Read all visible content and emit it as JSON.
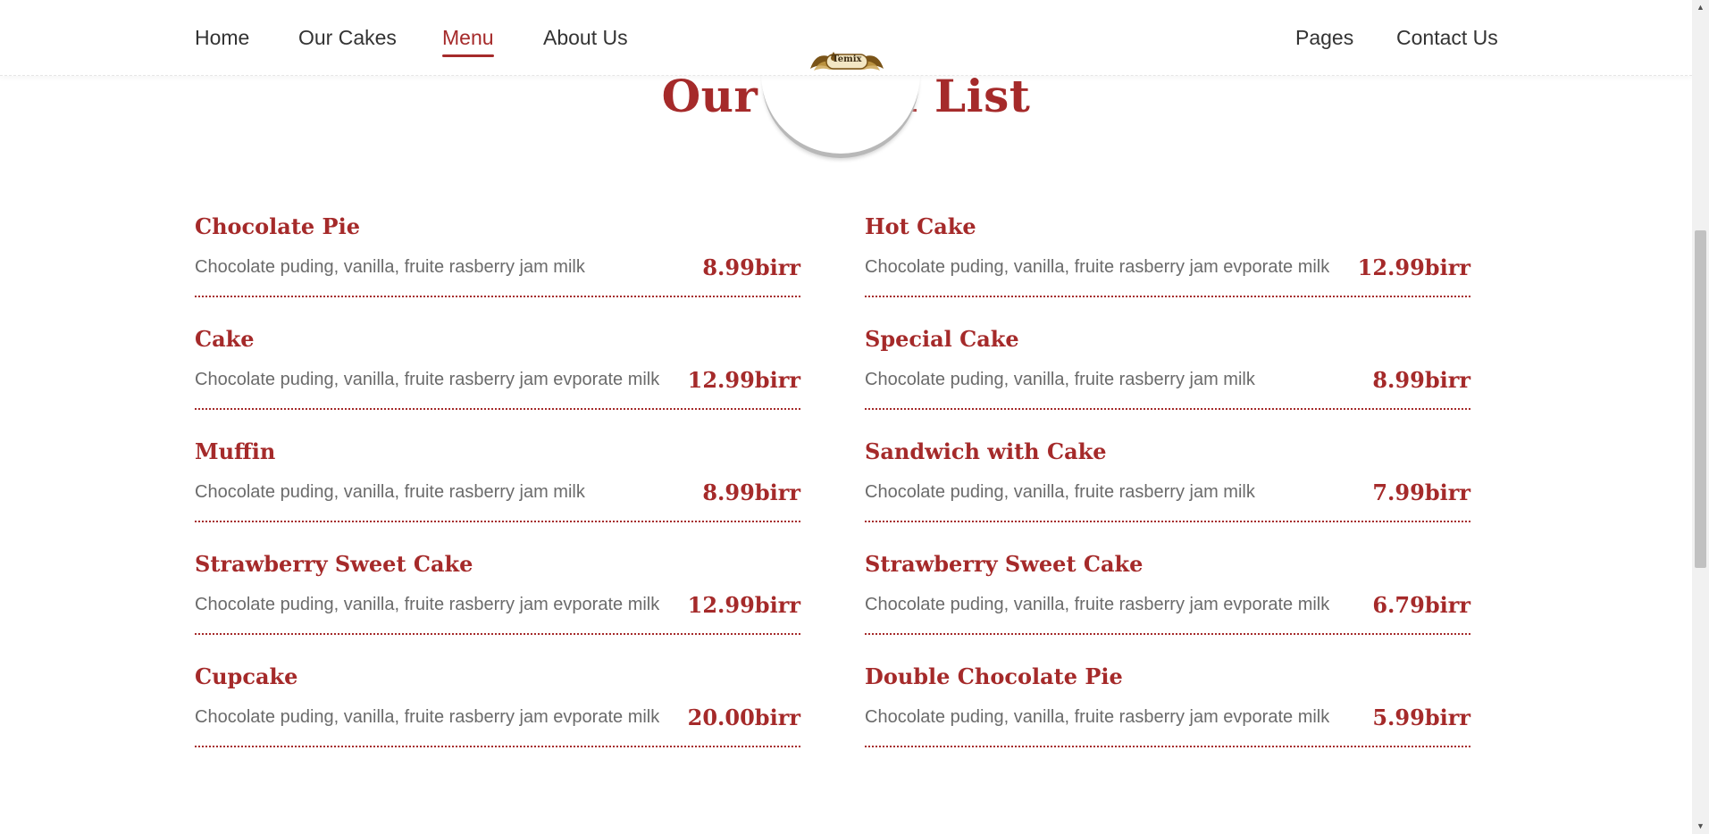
{
  "nav": {
    "left_links": [
      "Home",
      "Our Cakes",
      "Menu",
      "About Us"
    ],
    "right_links": [
      "Pages",
      "Contact Us"
    ],
    "active": "Menu"
  },
  "logo": {
    "text": "Temix",
    "icon": "cake-logo-icon"
  },
  "section": {
    "title": "Our Menu List"
  },
  "menu": {
    "left": [
      {
        "name": "Chocolate Pie",
        "description": "Chocolate puding, vanilla, fruite rasberry jam milk",
        "price": "8.99birr"
      },
      {
        "name": "Cake",
        "description": "Chocolate puding, vanilla, fruite rasberry jam evporate milk",
        "price": "12.99birr"
      },
      {
        "name": "Muffin",
        "description": "Chocolate puding, vanilla, fruite rasberry jam milk",
        "price": "8.99birr"
      },
      {
        "name": "Strawberry Sweet Cake",
        "description": "Chocolate puding, vanilla, fruite rasberry jam evporate milk",
        "price": "12.99birr"
      },
      {
        "name": "Cupcake",
        "description": "Chocolate puding, vanilla, fruite rasberry jam evporate milk",
        "price": "20.00birr"
      }
    ],
    "right": [
      {
        "name": "Hot Cake",
        "description": "Chocolate puding, vanilla, fruite rasberry jam evporate milk",
        "price": "12.99birr"
      },
      {
        "name": "Special Cake",
        "description": "Chocolate puding, vanilla, fruite rasberry jam milk",
        "price": "8.99birr"
      },
      {
        "name": "Sandwich with Cake",
        "description": "Chocolate puding, vanilla, fruite rasberry jam milk",
        "price": "7.99birr"
      },
      {
        "name": "Strawberry Sweet Cake",
        "description": "Chocolate puding, vanilla, fruite rasberry jam evporate milk",
        "price": "6.79birr"
      },
      {
        "name": "Double Chocolate Pie",
        "description": "Chocolate puding, vanilla, fruite rasberry jam evporate milk",
        "price": "5.99birr"
      }
    ]
  },
  "colors": {
    "accent": "#a52a2a",
    "nav_text": "#333333",
    "description_text": "#6b6b6b"
  }
}
